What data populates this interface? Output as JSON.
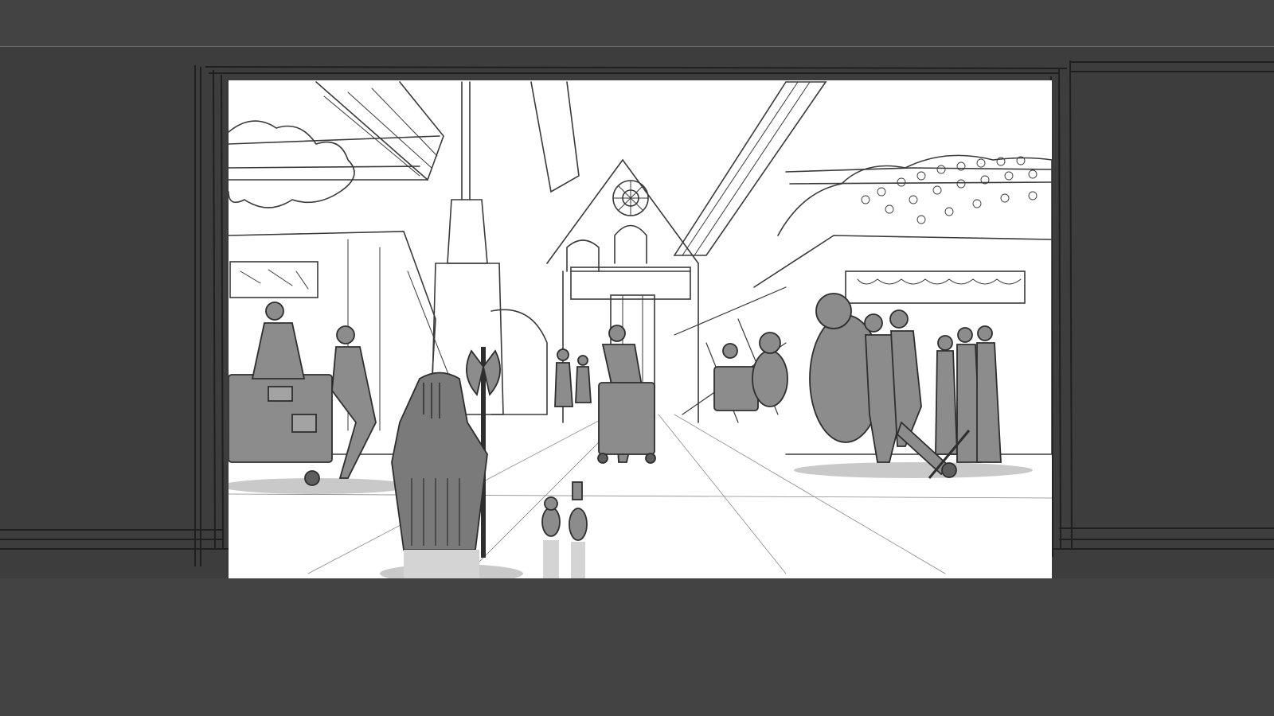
{
  "colors": {
    "background": "#434343",
    "frame": "#3d3d3d",
    "panel": "#ffffff",
    "sketch_line": "#3a3a3a",
    "figure_fill": "#8c8c8c",
    "figure_dark": "#5e5e5e",
    "shadow": "#c9c9c9"
  },
  "scene_icons": [
    "storyboard-frame",
    "sketch-panel",
    "arched-building",
    "rose-window",
    "conveyor-ramps",
    "foliage",
    "characters"
  ]
}
